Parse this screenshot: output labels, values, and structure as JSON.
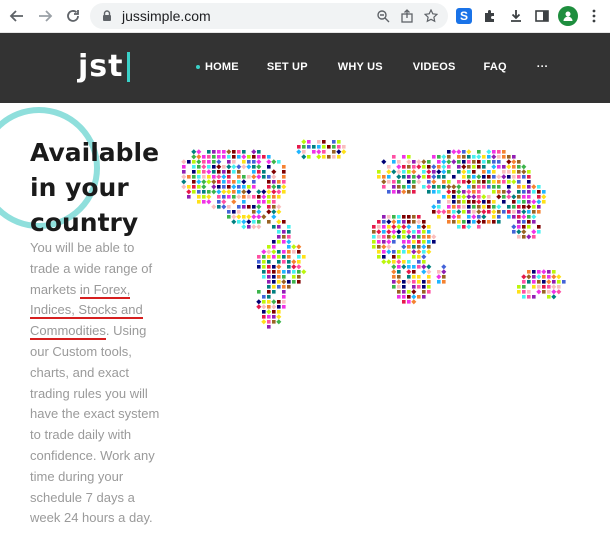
{
  "browser": {
    "url": "jussimple.com",
    "extensions": [
      "s-extension-icon",
      "puzzle-icon",
      "download-icon",
      "sidebar-icon",
      "profile-icon"
    ]
  },
  "site": {
    "logo": "jst",
    "nav": {
      "home": "HOME",
      "setup": "SET UP",
      "why_us": "WHY US",
      "videos": "VIDEOS",
      "faq": "FAQ",
      "more": "···"
    },
    "accent_color": "#3ad1c8",
    "header_bg": "#333333"
  },
  "hero": {
    "headline": [
      "Available",
      "in your",
      "country"
    ],
    "body": {
      "part1": "You will be able to trade a wide range of markets ",
      "highlight1": "in Forex,",
      "space1": " ",
      "highlight2": "Indices, Stocks and",
      "space2": " ",
      "highlight3": "Commodities",
      "part2": ". Using our Custom tools, charts, and exact trading rules you will have the exact system to trade daily with confidence. Work any time during your schedule 7 days a week 24 hours a day."
    },
    "underline_color": "#d61f1f"
  }
}
